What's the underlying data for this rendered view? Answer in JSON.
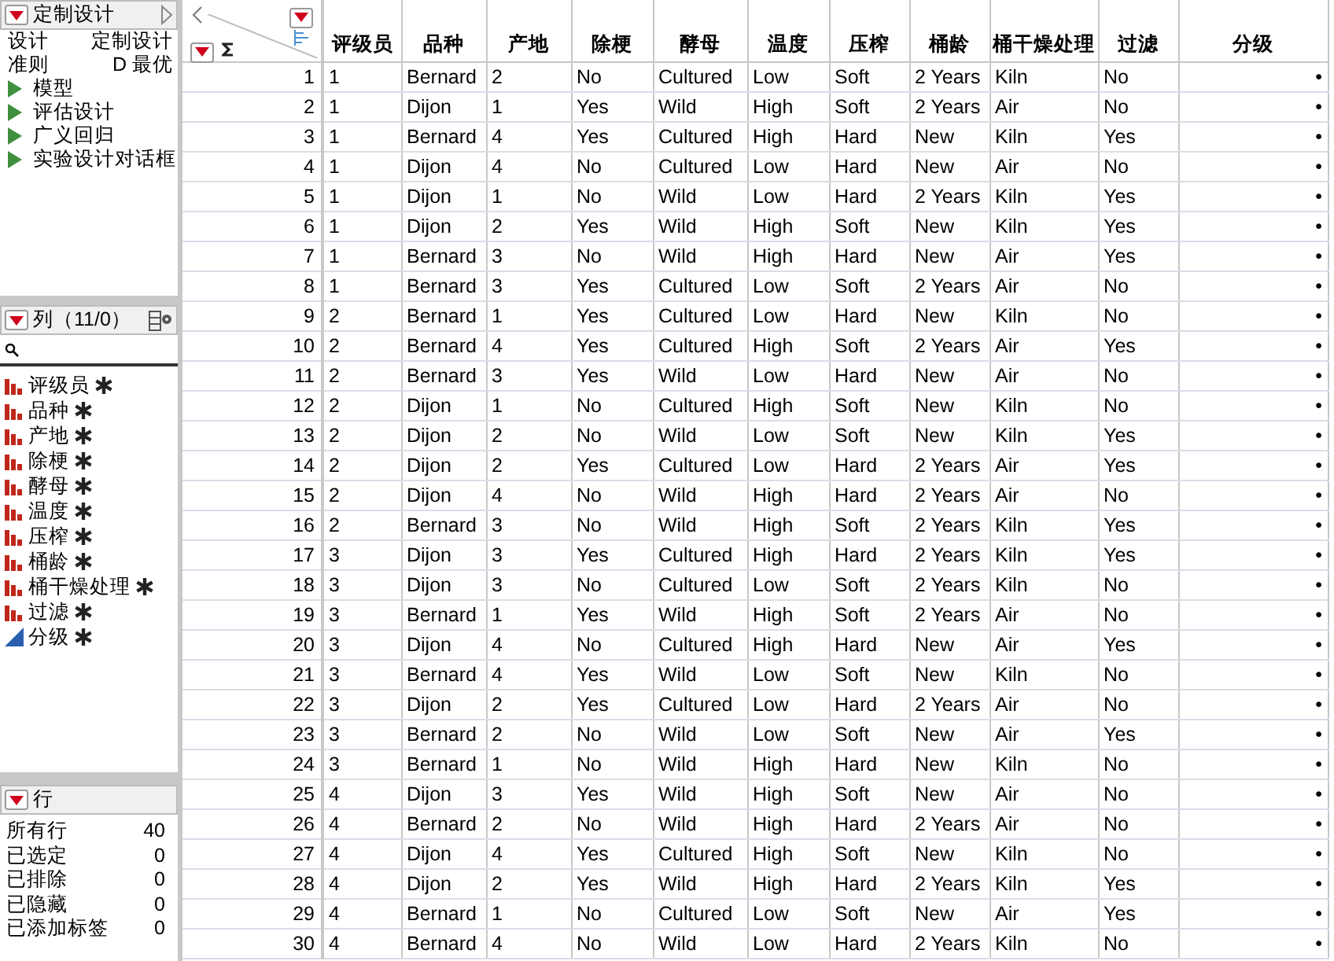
{
  "design_panel": {
    "title": "定制设计",
    "expanded": true,
    "info": [
      {
        "label": "设计",
        "value": "定制设计"
      },
      {
        "label": "准则",
        "value": "D 最优"
      }
    ],
    "items": [
      {
        "label": "模型",
        "expanded": false
      },
      {
        "label": "评估设计",
        "expanded": false
      },
      {
        "label": "广义回归",
        "expanded": false
      },
      {
        "label": "实验设计对话框",
        "expanded": false
      }
    ]
  },
  "columns_panel": {
    "title": "列（11/0）",
    "columns": [
      {
        "label": "评级员",
        "kind": "nominal"
      },
      {
        "label": "品种",
        "kind": "nominal"
      },
      {
        "label": "产地",
        "kind": "nominal"
      },
      {
        "label": "除梗",
        "kind": "nominal"
      },
      {
        "label": "酵母",
        "kind": "nominal"
      },
      {
        "label": "温度",
        "kind": "nominal"
      },
      {
        "label": "压榨",
        "kind": "nominal"
      },
      {
        "label": "桶龄",
        "kind": "nominal"
      },
      {
        "label": "桶干燥处理",
        "kind": "nominal"
      },
      {
        "label": "过滤",
        "kind": "nominal"
      },
      {
        "label": "分级",
        "kind": "continuous"
      }
    ]
  },
  "rows_panel": {
    "title": "行",
    "stats": [
      {
        "label": "所有行",
        "value": "40"
      },
      {
        "label": "已选定",
        "value": "0"
      },
      {
        "label": "已排除",
        "value": "0"
      },
      {
        "label": "已隐藏",
        "value": "0"
      },
      {
        "label": "已添加标签",
        "value": "0"
      }
    ]
  },
  "table": {
    "columns": [
      "评级员",
      "品种",
      "产地",
      "除梗",
      "酵母",
      "温度",
      "压榨",
      "桶龄",
      "桶干燥处理",
      "过滤",
      "分级"
    ],
    "rows": [
      {
        "number": "1",
        "cells": [
          "1",
          "Bernard",
          "2",
          "No",
          "Cultured",
          "Low",
          "Soft",
          "2 Years",
          "Kiln",
          "No",
          "•"
        ]
      },
      {
        "number": "2",
        "cells": [
          "1",
          "Dijon",
          "1",
          "Yes",
          "Wild",
          "High",
          "Soft",
          "2 Years",
          "Air",
          "No",
          "•"
        ]
      },
      {
        "number": "3",
        "cells": [
          "1",
          "Bernard",
          "4",
          "Yes",
          "Cultured",
          "High",
          "Hard",
          "New",
          "Kiln",
          "Yes",
          "•"
        ]
      },
      {
        "number": "4",
        "cells": [
          "1",
          "Dijon",
          "4",
          "No",
          "Cultured",
          "Low",
          "Hard",
          "New",
          "Air",
          "No",
          "•"
        ]
      },
      {
        "number": "5",
        "cells": [
          "1",
          "Dijon",
          "1",
          "No",
          "Wild",
          "Low",
          "Hard",
          "2 Years",
          "Kiln",
          "Yes",
          "•"
        ]
      },
      {
        "number": "6",
        "cells": [
          "1",
          "Dijon",
          "2",
          "Yes",
          "Wild",
          "High",
          "Soft",
          "New",
          "Kiln",
          "Yes",
          "•"
        ]
      },
      {
        "number": "7",
        "cells": [
          "1",
          "Bernard",
          "3",
          "No",
          "Wild",
          "High",
          "Hard",
          "New",
          "Air",
          "Yes",
          "•"
        ]
      },
      {
        "number": "8",
        "cells": [
          "1",
          "Bernard",
          "3",
          "Yes",
          "Cultured",
          "Low",
          "Soft",
          "2 Years",
          "Air",
          "No",
          "•"
        ]
      },
      {
        "number": "9",
        "cells": [
          "2",
          "Bernard",
          "1",
          "Yes",
          "Cultured",
          "Low",
          "Hard",
          "New",
          "Kiln",
          "No",
          "•"
        ]
      },
      {
        "number": "10",
        "cells": [
          "2",
          "Bernard",
          "4",
          "Yes",
          "Cultured",
          "High",
          "Soft",
          "2 Years",
          "Air",
          "Yes",
          "•"
        ]
      },
      {
        "number": "11",
        "cells": [
          "2",
          "Bernard",
          "3",
          "Yes",
          "Wild",
          "Low",
          "Hard",
          "New",
          "Air",
          "No",
          "•"
        ]
      },
      {
        "number": "12",
        "cells": [
          "2",
          "Dijon",
          "1",
          "No",
          "Cultured",
          "High",
          "Soft",
          "New",
          "Kiln",
          "No",
          "•"
        ]
      },
      {
        "number": "13",
        "cells": [
          "2",
          "Dijon",
          "2",
          "No",
          "Wild",
          "Low",
          "Soft",
          "New",
          "Kiln",
          "Yes",
          "•"
        ]
      },
      {
        "number": "14",
        "cells": [
          "2",
          "Dijon",
          "2",
          "Yes",
          "Cultured",
          "Low",
          "Hard",
          "2 Years",
          "Air",
          "Yes",
          "•"
        ]
      },
      {
        "number": "15",
        "cells": [
          "2",
          "Dijon",
          "4",
          "No",
          "Wild",
          "High",
          "Hard",
          "2 Years",
          "Air",
          "No",
          "•"
        ]
      },
      {
        "number": "16",
        "cells": [
          "2",
          "Bernard",
          "3",
          "No",
          "Wild",
          "High",
          "Soft",
          "2 Years",
          "Kiln",
          "Yes",
          "•"
        ]
      },
      {
        "number": "17",
        "cells": [
          "3",
          "Dijon",
          "3",
          "Yes",
          "Cultured",
          "High",
          "Hard",
          "2 Years",
          "Kiln",
          "Yes",
          "•"
        ]
      },
      {
        "number": "18",
        "cells": [
          "3",
          "Dijon",
          "3",
          "No",
          "Cultured",
          "Low",
          "Soft",
          "2 Years",
          "Kiln",
          "No",
          "•"
        ]
      },
      {
        "number": "19",
        "cells": [
          "3",
          "Bernard",
          "1",
          "Yes",
          "Wild",
          "High",
          "Soft",
          "2 Years",
          "Air",
          "No",
          "•"
        ]
      },
      {
        "number": "20",
        "cells": [
          "3",
          "Dijon",
          "4",
          "No",
          "Cultured",
          "High",
          "Hard",
          "New",
          "Air",
          "Yes",
          "•"
        ]
      },
      {
        "number": "21",
        "cells": [
          "3",
          "Bernard",
          "4",
          "Yes",
          "Wild",
          "Low",
          "Soft",
          "New",
          "Kiln",
          "No",
          "•"
        ]
      },
      {
        "number": "22",
        "cells": [
          "3",
          "Dijon",
          "2",
          "Yes",
          "Cultured",
          "Low",
          "Hard",
          "2 Years",
          "Air",
          "No",
          "•"
        ]
      },
      {
        "number": "23",
        "cells": [
          "3",
          "Bernard",
          "2",
          "No",
          "Wild",
          "Low",
          "Soft",
          "New",
          "Air",
          "Yes",
          "•"
        ]
      },
      {
        "number": "24",
        "cells": [
          "3",
          "Bernard",
          "1",
          "No",
          "Wild",
          "High",
          "Hard",
          "New",
          "Kiln",
          "No",
          "•"
        ]
      },
      {
        "number": "25",
        "cells": [
          "4",
          "Dijon",
          "3",
          "Yes",
          "Wild",
          "High",
          "Soft",
          "New",
          "Air",
          "No",
          "•"
        ]
      },
      {
        "number": "26",
        "cells": [
          "4",
          "Bernard",
          "2",
          "No",
          "Wild",
          "High",
          "Hard",
          "2 Years",
          "Air",
          "No",
          "•"
        ]
      },
      {
        "number": "27",
        "cells": [
          "4",
          "Dijon",
          "4",
          "Yes",
          "Cultured",
          "High",
          "Soft",
          "New",
          "Kiln",
          "No",
          "•"
        ]
      },
      {
        "number": "28",
        "cells": [
          "4",
          "Dijon",
          "2",
          "Yes",
          "Wild",
          "High",
          "Hard",
          "2 Years",
          "Kiln",
          "Yes",
          "•"
        ]
      },
      {
        "number": "29",
        "cells": [
          "4",
          "Bernard",
          "1",
          "No",
          "Cultured",
          "Low",
          "Soft",
          "New",
          "Air",
          "Yes",
          "•"
        ]
      },
      {
        "number": "30",
        "cells": [
          "4",
          "Bernard",
          "4",
          "No",
          "Wild",
          "Low",
          "Hard",
          "2 Years",
          "Kiln",
          "No",
          "•"
        ]
      }
    ]
  }
}
